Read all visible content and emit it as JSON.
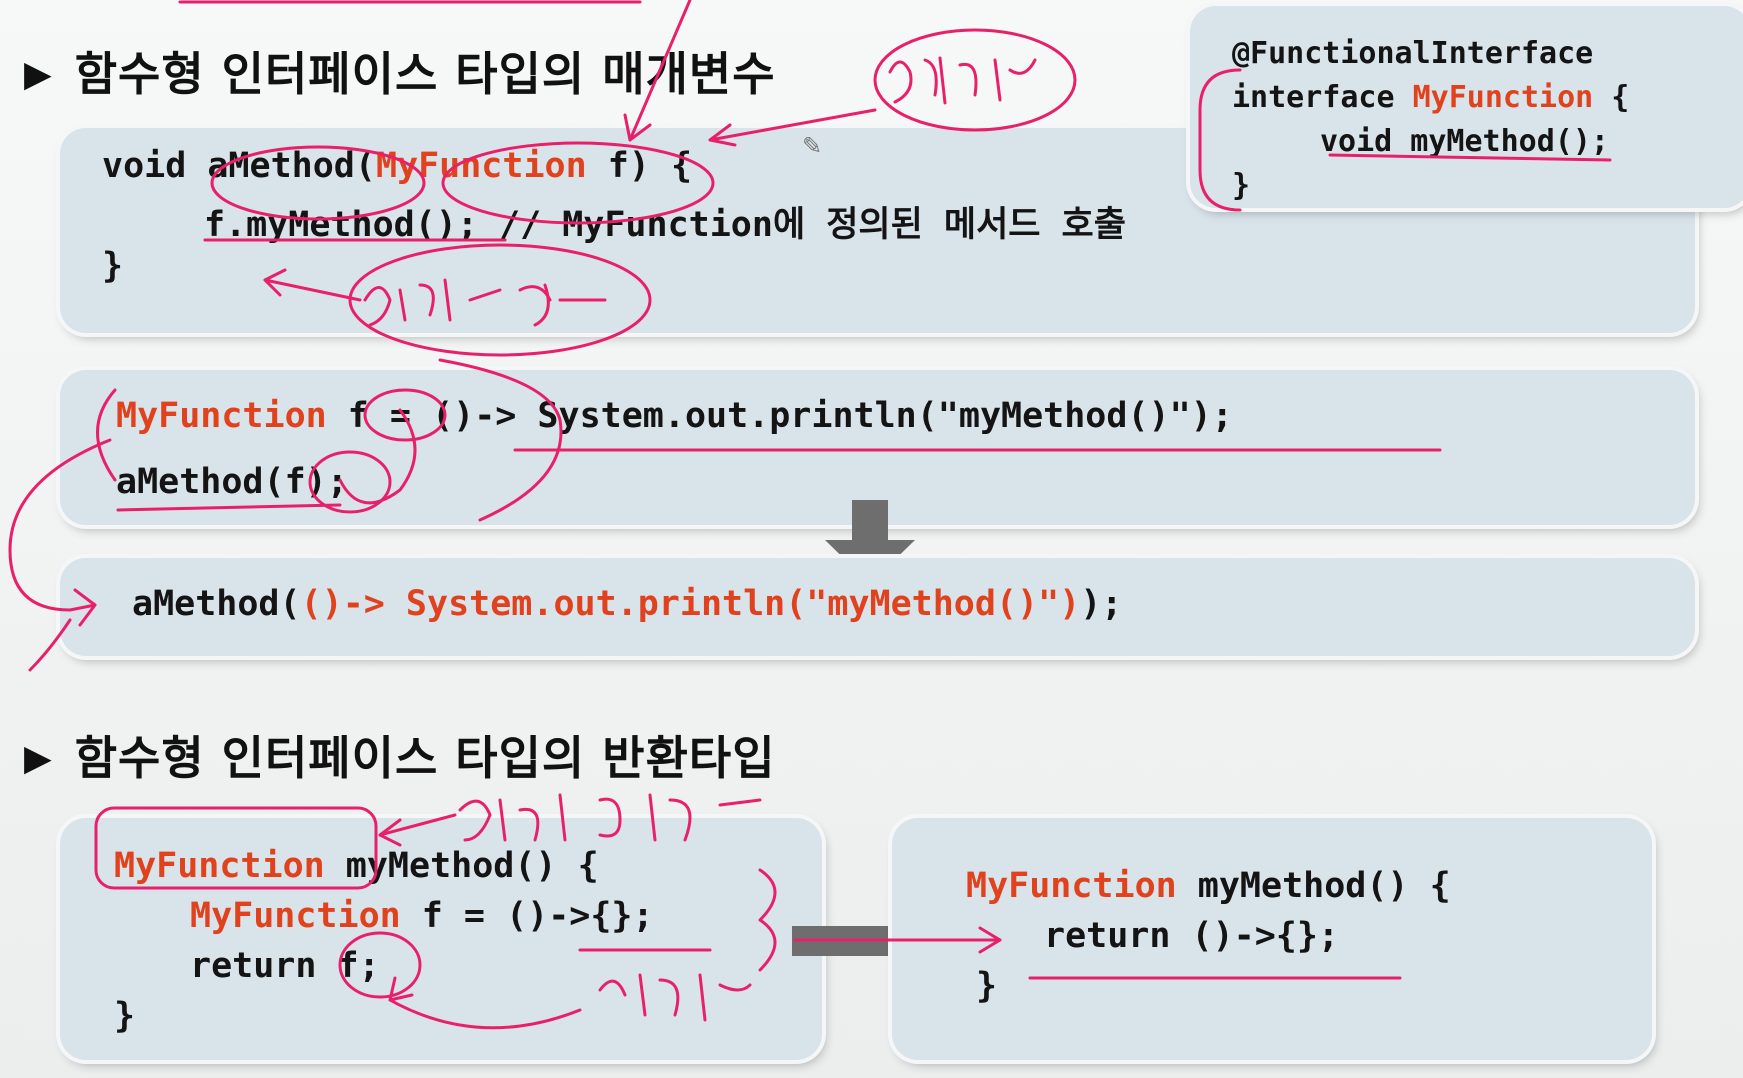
{
  "section1": {
    "heading": "함수형 인터페이스 타입의 매개변수"
  },
  "iface_box": {
    "line1": "@FunctionalInterface",
    "line2_kw": "interface ",
    "line2_name": "MyFunction",
    "line2_end": " {",
    "line3": "void myMethod();",
    "line4": "}"
  },
  "method_box": {
    "line1_a": "void aMethod(",
    "line1_type": "MyFunction",
    "line1_b": " f) {",
    "line2": "f.myMethod(); // MyFunction에 정의된 메서드 호출",
    "line3": "}"
  },
  "call_box": {
    "line1_type": "MyFunction",
    "line1_rest": " f = ()-> System.out.println(\"myMethod()\");",
    "line2": "aMethod(f);"
  },
  "inline_box": {
    "pre": "aMethod(",
    "lambda": "()-> System.out.println(\"myMethod()\")",
    "post": ");"
  },
  "section2": {
    "heading": "함수형 인터페이스 타입의 반환타입"
  },
  "return_box_left": {
    "line1_type": "MyFunction",
    "line1_rest": " myMethod() {",
    "line2_type": "MyFunction",
    "line2_rest": " f = ()->{};",
    "line3": "return f;",
    "line4": "}"
  },
  "return_box_right": {
    "line1_type": "MyFunction",
    "line1_rest": " myMethod() {",
    "line2": "return ()->{};",
    "line3": "}"
  },
  "colors": {
    "accent_red": "#e0421e",
    "ink_pink": "#e8206a",
    "box_bg": "#d9e3ea",
    "arrow_gray": "#6e6e6e"
  }
}
